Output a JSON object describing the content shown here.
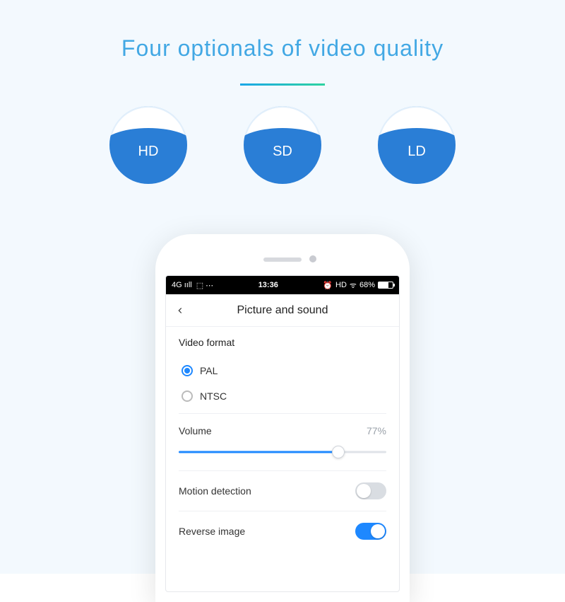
{
  "headline": "Four optionals of  video quality",
  "bubbles": [
    "HD",
    "SD",
    "LD"
  ],
  "statusbar": {
    "left": "4G ııll",
    "android": "⬚ ⋯",
    "time": "13:36",
    "alarm": "⏰",
    "hd": "HD",
    "wifi": "ᯤ",
    "battery_pct": "68%"
  },
  "nav": {
    "title": "Picture and sound"
  },
  "video_format": {
    "label": "Video format",
    "options": [
      {
        "label": "PAL",
        "checked": true
      },
      {
        "label": "NTSC",
        "checked": false
      }
    ]
  },
  "volume": {
    "label": "Volume",
    "value_text": "77%",
    "percent": 77
  },
  "toggles": [
    {
      "label": "Motion detection",
      "on": false
    },
    {
      "label": "Reverse image",
      "on": true
    }
  ]
}
